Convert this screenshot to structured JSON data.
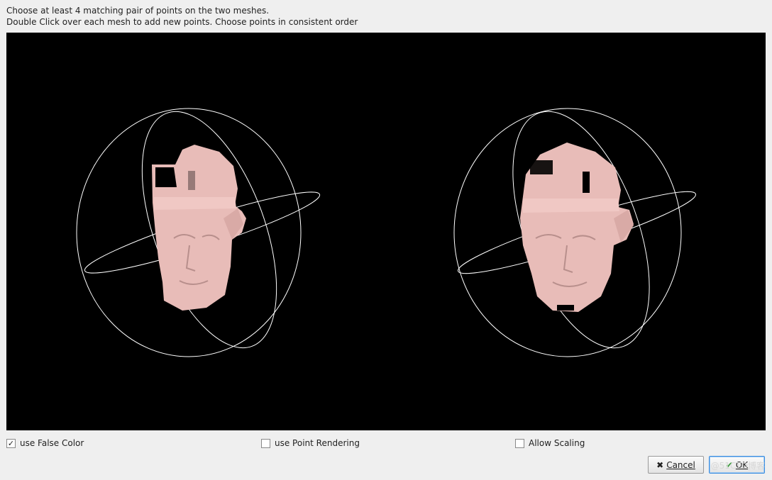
{
  "instructions": {
    "line1": "Choose at least 4 matching pair of points on the two meshes.",
    "line2": "Double Click over each mesh to add new points. Choose points in consistent order"
  },
  "viewport": {
    "background": "#000000",
    "mesh_color": "#e8bcb8",
    "trackball_color": "#ffffff",
    "meshes": [
      "left",
      "right"
    ]
  },
  "options": {
    "false_color": {
      "label": "use False Color",
      "checked": true
    },
    "point_rendering": {
      "label": "use Point Rendering",
      "checked": false
    },
    "allow_scaling": {
      "label": "Allow Scaling",
      "checked": false
    }
  },
  "buttons": {
    "cancel": {
      "label": "Cancel",
      "icon": "x-icon"
    },
    "ok": {
      "label": "OK",
      "icon": "checkmark-icon"
    }
  },
  "watermark": "@51CTO博客"
}
